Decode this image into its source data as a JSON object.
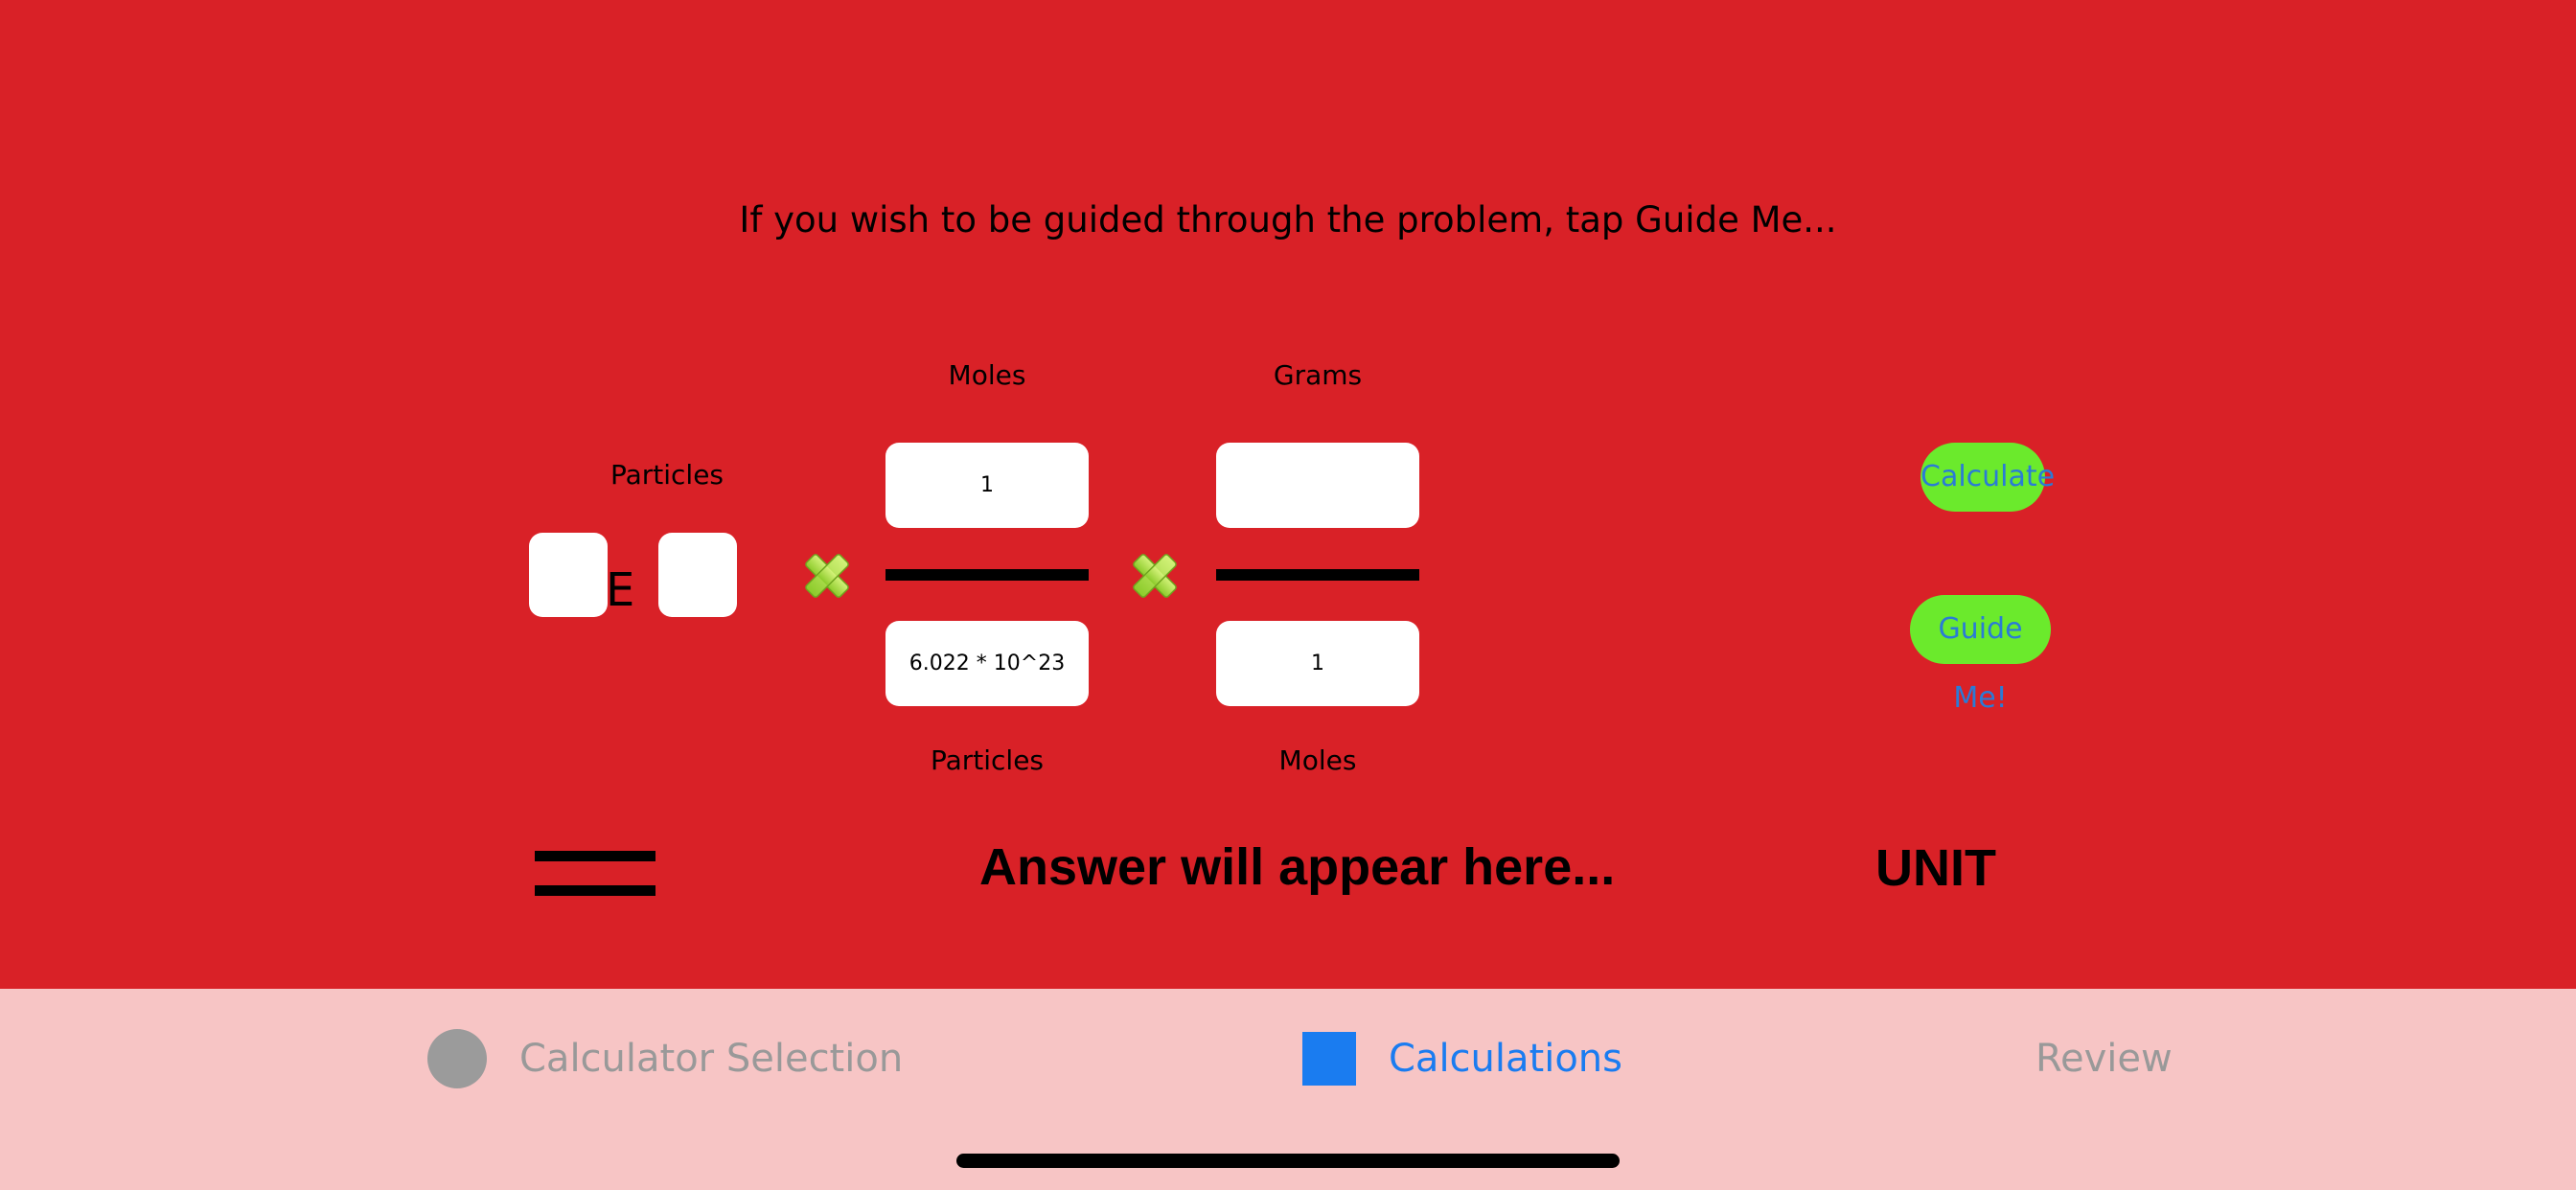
{
  "instruction": "If you wish to be guided through the problem, tap Guide Me...",
  "particles_input": {
    "label": "Particles",
    "coefficient_value": "",
    "e_label": "E",
    "exponent_value": ""
  },
  "factor1": {
    "top_label": "Moles",
    "numerator": "1",
    "denominator": "6.022 * 10^23",
    "bottom_label": "Particles"
  },
  "factor2": {
    "top_label": "Grams",
    "numerator": "",
    "denominator": "1",
    "bottom_label": "Moles"
  },
  "buttons": {
    "calculate": "Calculate",
    "guide_me": "Guide Me!"
  },
  "result": {
    "answer": "Answer will appear here...",
    "unit": "UNIT"
  },
  "tabs": [
    {
      "label": "Calculator Selection",
      "icon": "circle-icon",
      "state": "inactive"
    },
    {
      "label": "Calculations",
      "icon": "square-icon",
      "state": "active"
    },
    {
      "label": "Review",
      "icon": "",
      "state": "inactive"
    }
  ],
  "colors": {
    "background": "#D92127",
    "tabbar": "#F7C5C5",
    "button_fill": "#6BEA2C",
    "button_text": "#2A7BD6",
    "tab_active": "#1A7CF0",
    "tab_inactive": "#999999"
  }
}
